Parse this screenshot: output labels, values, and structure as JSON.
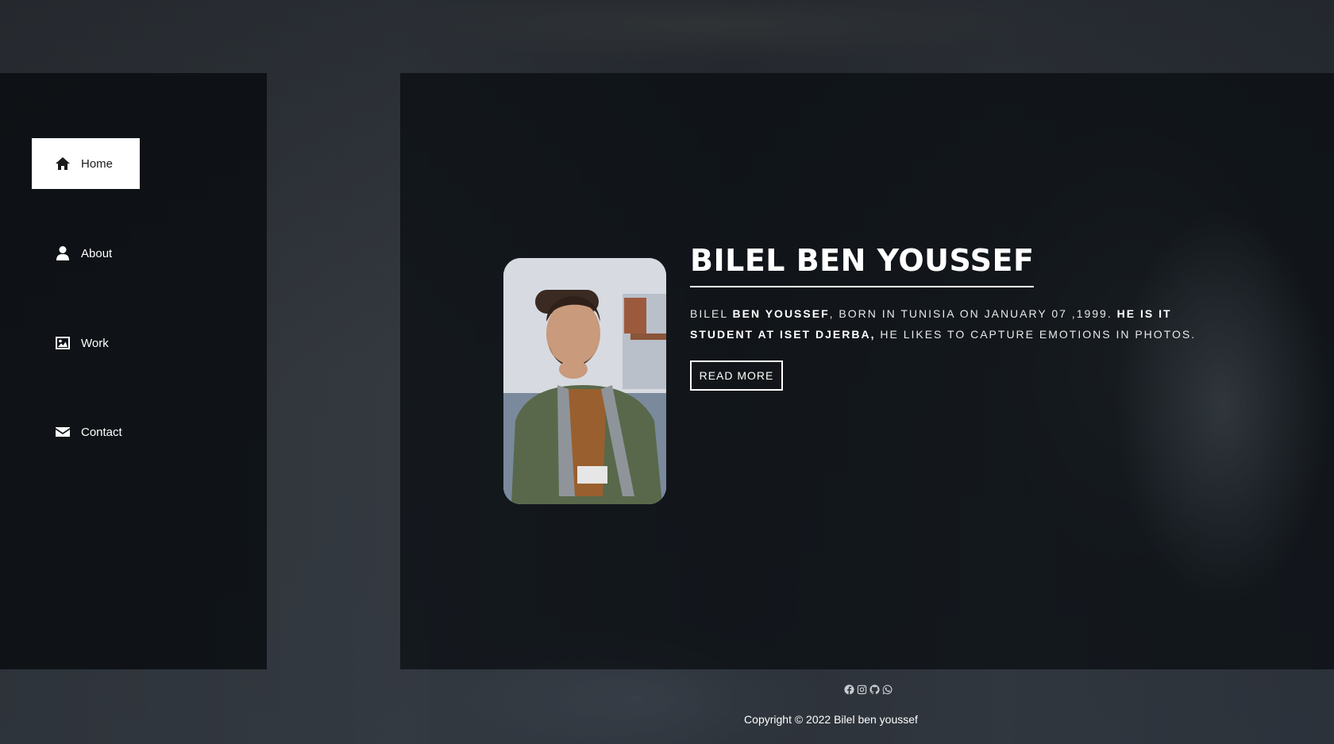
{
  "nav": {
    "items": [
      {
        "label": "Home",
        "icon": "home-icon",
        "active": true
      },
      {
        "label": "About",
        "icon": "user-icon",
        "active": false
      },
      {
        "label": "Work",
        "icon": "image-icon",
        "active": false
      },
      {
        "label": "Contact",
        "icon": "envelope-icon",
        "active": false
      }
    ]
  },
  "hero": {
    "name": "BILEL BEN YOUSSEF",
    "bio": {
      "part1": "Bilel ",
      "part2_bold": "Ben Youssef",
      "part3": ", born in Tunisia on January 07 ,1999. ",
      "part4_bold": "He is IT student at ISET Djerba,",
      "part5": " he likes to capture emotions in photos."
    },
    "button_label": "READ MORE"
  },
  "footer": {
    "social_icons": [
      "facebook-icon",
      "instagram-icon",
      "github-icon",
      "whatsapp-icon"
    ],
    "copyright": "Copyright © 2022 Bilel ben youssef"
  },
  "colors": {
    "panel": "#0b0f13",
    "active_nav_bg": "#ffffff",
    "text": "#ffffff"
  }
}
